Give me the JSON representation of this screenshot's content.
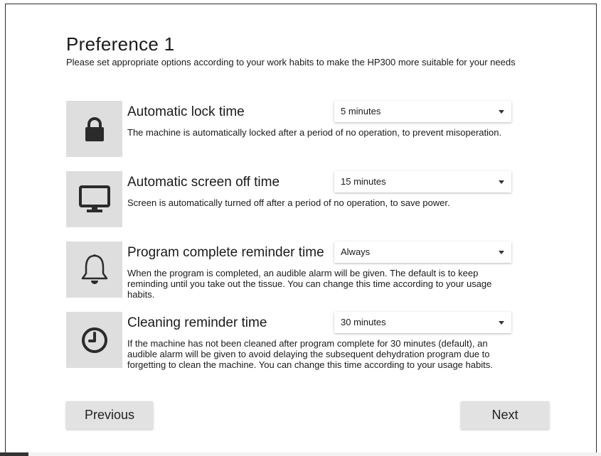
{
  "page": {
    "title": "Preference 1",
    "subtitle": "Please set appropriate options according to your work habits to make the HP300 more suitable for your needs"
  },
  "settings": [
    {
      "icon": "lock-icon",
      "title": "Automatic lock time",
      "value": "5 minutes",
      "description": "The machine is automatically locked after a period of no operation, to prevent misoperation."
    },
    {
      "icon": "monitor-icon",
      "title": "Automatic screen off time",
      "value": "15 minutes",
      "description": "Screen is automatically turned off after a period of no operation, to save power."
    },
    {
      "icon": "bell-icon",
      "title": "Program complete reminder time",
      "value": "Always",
      "description": "When the program is completed, an audible alarm will be given. The default is to keep reminding until you take out the tissue. You can change this time according to your usage habits."
    },
    {
      "icon": "clock-icon",
      "title": "Cleaning reminder time",
      "value": "30 minutes",
      "description": "If the machine has not been cleaned after program complete for 30 minutes (default), an audible alarm will be given to avoid delaying the subsequent dehydration program due to forgetting to clean the machine. You can change this time according to your usage habits."
    }
  ],
  "navigation": {
    "previous_label": "Previous",
    "next_label": "Next"
  },
  "colors": {
    "icon_bg": "#dedede",
    "icon_fg": "#2b2b2b",
    "button_bg": "#e2e2e2"
  }
}
